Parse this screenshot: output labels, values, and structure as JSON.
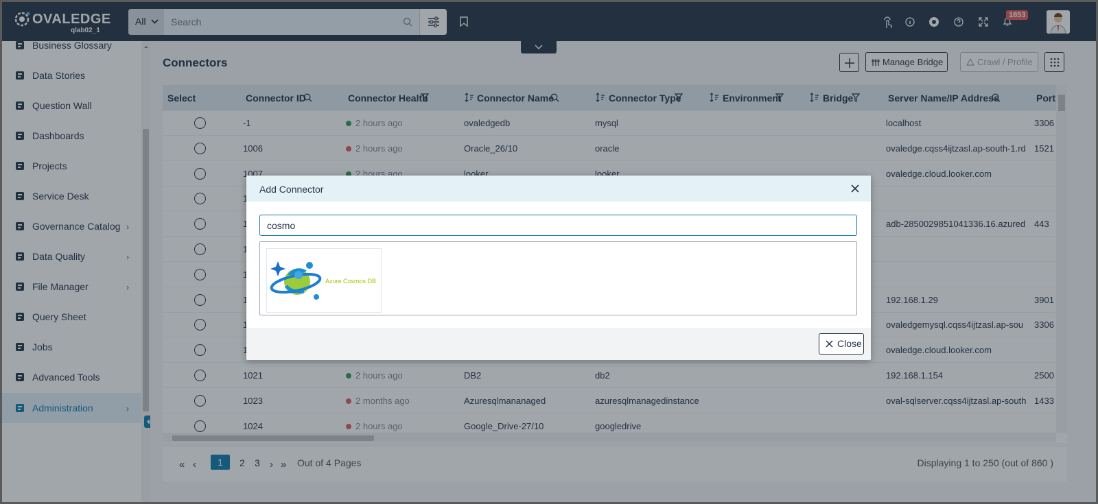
{
  "header": {
    "logo_text": "OVALEDGE",
    "logo_sub": "qlab02_1",
    "search_scope": "All",
    "search_placeholder": "Search",
    "notification_count": "1853"
  },
  "sidebar": {
    "items": [
      {
        "label": "Business Glossary",
        "icon": "book-icon",
        "has_chevron": false
      },
      {
        "label": "Data Stories",
        "icon": "stories-icon",
        "has_chevron": false
      },
      {
        "label": "Question Wall",
        "icon": "chat-icon",
        "has_chevron": false
      },
      {
        "label": "Dashboards",
        "icon": "dashboard-icon",
        "has_chevron": false
      },
      {
        "label": "Projects",
        "icon": "clipboard-icon",
        "has_chevron": false
      },
      {
        "label": "Service Desk",
        "icon": "service-desk-icon",
        "has_chevron": false
      },
      {
        "label": "Governance Catalog",
        "icon": "bank-icon",
        "has_chevron": true
      },
      {
        "label": "Data Quality",
        "icon": "database-check-icon",
        "has_chevron": true
      },
      {
        "label": "File Manager",
        "icon": "folder-icon",
        "has_chevron": true
      },
      {
        "label": "Query Sheet",
        "icon": "code-icon",
        "has_chevron": false
      },
      {
        "label": "Jobs",
        "icon": "jobs-icon",
        "has_chevron": false
      },
      {
        "label": "Advanced Tools",
        "icon": "tools-icon",
        "has_chevron": false
      },
      {
        "label": "Administration",
        "icon": "admin-icon",
        "has_chevron": true,
        "active": true
      }
    ]
  },
  "page": {
    "title": "Connectors",
    "manage_bridge": "Manage Bridge",
    "crawl_profile": "Crawl / Profile"
  },
  "table": {
    "columns": [
      "Select",
      "Connector ID",
      "Connector Health",
      "Connector Name",
      "Connector Type",
      "Environment",
      "Bridge",
      "Server Name/IP Address",
      "Port"
    ],
    "rows": [
      {
        "id": "-1",
        "health": "2 hours ago",
        "status": "green",
        "name": "ovaledgedb",
        "type": "mysql",
        "server": "localhost",
        "port": "3306"
      },
      {
        "id": "1006",
        "health": "2 hours ago",
        "status": "red",
        "name": "Oracle_26/10",
        "type": "oracle",
        "server": "ovaledge.cqss4ijtzasl.ap-south-1.rd",
        "port": "1521"
      },
      {
        "id": "1007",
        "health": "2 hours ago",
        "status": "green",
        "name": "looker",
        "type": "looker",
        "server": "ovaledge.cloud.looker.com",
        "port": ""
      },
      {
        "id": "1",
        "health": "",
        "status": "",
        "name": "",
        "type": "",
        "server": "",
        "port": ""
      },
      {
        "id": "1",
        "health": "",
        "status": "",
        "name": "",
        "type": "",
        "server": "adb-2850029851041336.16.azured",
        "port": "443"
      },
      {
        "id": "1",
        "health": "",
        "status": "",
        "name": "",
        "type": "",
        "server": "",
        "port": ""
      },
      {
        "id": "1",
        "health": "",
        "status": "",
        "name": "",
        "type": "",
        "server": "",
        "port": ""
      },
      {
        "id": "1",
        "health": "",
        "status": "",
        "name": "",
        "type": "",
        "server": "192.168.1.29",
        "port": "3901"
      },
      {
        "id": "1",
        "health": "",
        "status": "",
        "name": "",
        "type": "",
        "server": "ovaledgemysql.cqss4ijtzasl.ap-sou",
        "port": "3306"
      },
      {
        "id": "1",
        "health": "",
        "status": "",
        "name": "",
        "type": "",
        "server": "ovaledge.cloud.looker.com",
        "port": ""
      },
      {
        "id": "1021",
        "health": "2 hours ago",
        "status": "green",
        "name": "DB2",
        "type": "db2",
        "server": "192.168.1.154",
        "port": "2500"
      },
      {
        "id": "1023",
        "health": "2 months ago",
        "status": "red",
        "name": "Azuresqlmananaged",
        "type": "azuresqlmanagedinstance",
        "server": "oval-sqlserver.cqss4ijtzasl.ap-south",
        "port": "1433"
      },
      {
        "id": "1024",
        "health": "2 hours ago",
        "status": "red",
        "name": "Google_Drive-27/10",
        "type": "googledrive",
        "server": "",
        "port": ""
      }
    ]
  },
  "pager": {
    "pages": [
      "1",
      "2",
      "3"
    ],
    "out_of": "Out of 4 Pages",
    "displaying": "Displaying 1 to 250  (out of 860 )"
  },
  "modal": {
    "title": "Add Connector",
    "search_value": "cosmo",
    "result_label": "Azure Cosmos DB",
    "close_label": "Close"
  },
  "colors": {
    "topbar": "#253545",
    "accent": "#0e7cab",
    "healthy": "#2e9d57",
    "unhealthy": "#e06060"
  }
}
